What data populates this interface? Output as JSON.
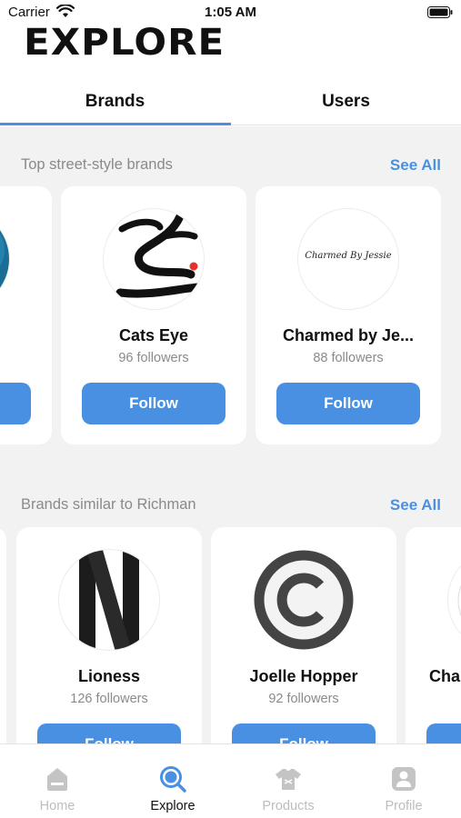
{
  "status_bar": {
    "carrier": "Carrier",
    "time": "1:05 AM"
  },
  "page_title": "EXPLORE",
  "tabs": [
    {
      "label": "Brands"
    },
    {
      "label": "Users"
    }
  ],
  "sections": [
    {
      "title": "Top street-style brands",
      "see_all": "See All",
      "cards": [
        {
          "name": "Cats Eye",
          "followers": "96 followers",
          "follow_label": "Follow",
          "avatar": "cats-eye-logo"
        },
        {
          "name": "Charmed by Je...",
          "followers": "88 followers",
          "follow_label": "Follow",
          "avatar": "charmed-by-jessie-logo",
          "logo_text": "Charmed By Jessie"
        }
      ]
    },
    {
      "title": "Brands similar to Richman",
      "see_all": "See All",
      "cards": [
        {
          "name": "Lioness",
          "followers": "126 followers",
          "follow_label": "Follow",
          "avatar": "lioness-logo"
        },
        {
          "name": "Joelle Hopper",
          "followers": "92 followers",
          "follow_label": "Follow",
          "avatar": "copyright-logo"
        },
        {
          "name": "Cha",
          "followers": "",
          "follow_label": "",
          "avatar": "partial-logo"
        }
      ]
    }
  ],
  "bottom_nav": [
    {
      "label": "Home",
      "icon": "home-icon",
      "active": false
    },
    {
      "label": "Explore",
      "icon": "search-icon",
      "active": true
    },
    {
      "label": "Products",
      "icon": "shirt-icon",
      "active": false
    },
    {
      "label": "Profile",
      "icon": "profile-icon",
      "active": false
    }
  ],
  "colors": {
    "accent": "#4a90e2",
    "muted_text": "#8a8a8a",
    "background": "#f2f2f2",
    "inactive_nav": "#bdbdbd"
  }
}
